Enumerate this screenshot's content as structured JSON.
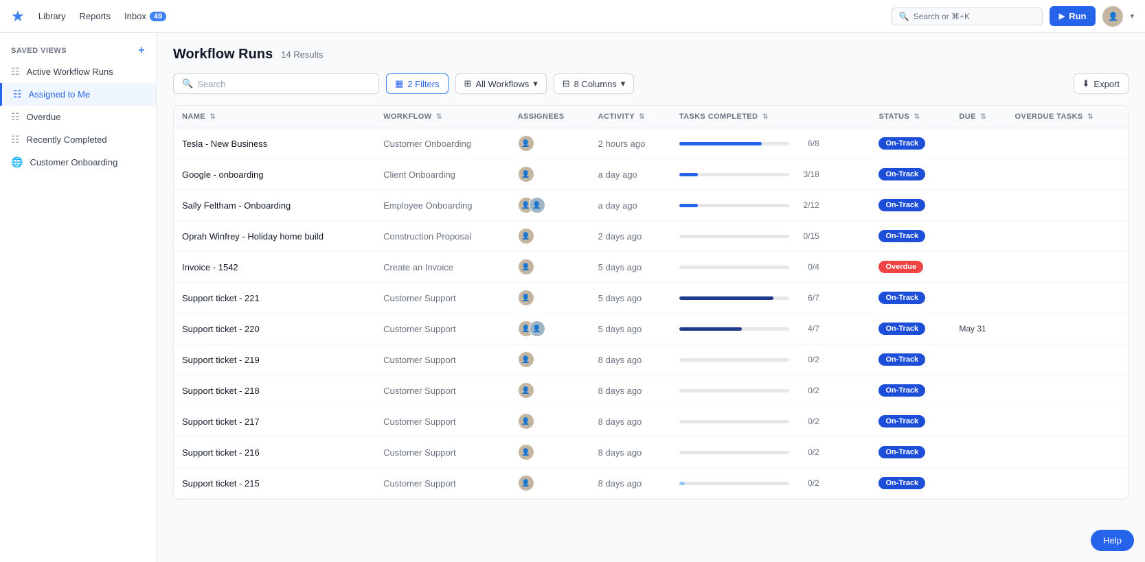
{
  "topnav": {
    "logo_symbol": "★",
    "library_label": "Library",
    "reports_label": "Reports",
    "inbox_label": "Inbox",
    "inbox_count": "49",
    "search_placeholder": "Search or ⌘+K",
    "run_label": "Run",
    "run_icon": "▶"
  },
  "sidebar": {
    "section_label": "SAVED VIEWS",
    "add_icon": "+",
    "items": [
      {
        "id": "active-workflow-runs",
        "label": "Active Workflow Runs",
        "icon": "☷"
      },
      {
        "id": "assigned-to-me",
        "label": "Assigned to Me",
        "icon": "☷",
        "active": true
      },
      {
        "id": "overdue",
        "label": "Overdue",
        "icon": "☷"
      },
      {
        "id": "recently-completed",
        "label": "Recently Completed",
        "icon": "☷"
      },
      {
        "id": "customer-onboarding",
        "label": "Customer Onboarding",
        "icon": "🌐"
      }
    ]
  },
  "main": {
    "title": "Workflow Runs",
    "results": "14 Results",
    "search_placeholder": "Search",
    "filters_label": "2 Filters",
    "workflows_label": "All Workflows",
    "columns_label": "8 Columns",
    "export_label": "Export"
  },
  "table": {
    "columns": [
      {
        "id": "name",
        "label": "NAME"
      },
      {
        "id": "workflow",
        "label": "WORKFLOW"
      },
      {
        "id": "assignees",
        "label": "ASSIGNEES"
      },
      {
        "id": "activity",
        "label": "ACTIVITY"
      },
      {
        "id": "tasks_completed",
        "label": "TASKS COMPLETED"
      },
      {
        "id": "status",
        "label": "STATUS"
      },
      {
        "id": "due",
        "label": "DUE"
      },
      {
        "id": "overdue_tasks",
        "label": "OVERDUE TASKS"
      }
    ],
    "rows": [
      {
        "name": "Tesla - New Business",
        "workflow": "Customer Onboarding",
        "assignees": 1,
        "activity": "2 hours ago",
        "progress": 75,
        "progress_color": "#2563eb",
        "tasks_completed": "6/8",
        "status": "On-Track",
        "status_type": "on-track",
        "due": "",
        "overdue_tasks": ""
      },
      {
        "name": "Google - onboarding",
        "workflow": "Client Onboarding",
        "assignees": 1,
        "activity": "a day ago",
        "progress": 17,
        "progress_color": "#2563eb",
        "tasks_completed": "3/18",
        "status": "On-Track",
        "status_type": "on-track",
        "due": "",
        "overdue_tasks": ""
      },
      {
        "name": "Sally Feltham - Onboarding",
        "workflow": "Employee Onboarding",
        "assignees": 2,
        "activity": "a day ago",
        "progress": 17,
        "progress_color": "#2563eb",
        "tasks_completed": "2/12",
        "status": "On-Track",
        "status_type": "on-track",
        "due": "",
        "overdue_tasks": ""
      },
      {
        "name": "Oprah Winfrey - Holiday home build",
        "workflow": "Construction Proposal",
        "assignees": 1,
        "activity": "2 days ago",
        "progress": 0,
        "progress_color": "#d1d5db",
        "tasks_completed": "0/15",
        "status": "On-Track",
        "status_type": "on-track",
        "due": "",
        "overdue_tasks": ""
      },
      {
        "name": "Invoice - 1542",
        "workflow": "Create an Invoice",
        "assignees": 1,
        "activity": "5 days ago",
        "progress": 0,
        "progress_color": "#fca5a5",
        "tasks_completed": "0/4",
        "status": "Overdue",
        "status_type": "overdue",
        "due": "",
        "overdue_tasks": ""
      },
      {
        "name": "Support ticket - 221",
        "workflow": "Customer Support",
        "assignees": 1,
        "activity": "5 days ago",
        "progress": 86,
        "progress_color": "#1e3a8a",
        "tasks_completed": "6/7",
        "status": "On-Track",
        "status_type": "on-track",
        "due": "",
        "overdue_tasks": ""
      },
      {
        "name": "Support ticket - 220",
        "workflow": "Customer Support",
        "assignees": 2,
        "activity": "5 days ago",
        "progress": 57,
        "progress_color": "#1e3a8a",
        "tasks_completed": "4/7",
        "status": "On-Track",
        "status_type": "on-track",
        "due": "May 31",
        "overdue_tasks": ""
      },
      {
        "name": "Support ticket - 219",
        "workflow": "Customer Support",
        "assignees": 1,
        "activity": "8 days ago",
        "progress": 0,
        "progress_color": "#d1d5db",
        "tasks_completed": "0/2",
        "status": "On-Track",
        "status_type": "on-track",
        "due": "",
        "overdue_tasks": ""
      },
      {
        "name": "Support ticket - 218",
        "workflow": "Customer Support",
        "assignees": 1,
        "activity": "8 days ago",
        "progress": 0,
        "progress_color": "#d1d5db",
        "tasks_completed": "0/2",
        "status": "On-Track",
        "status_type": "on-track",
        "due": "",
        "overdue_tasks": ""
      },
      {
        "name": "Support ticket - 217",
        "workflow": "Customer Support",
        "assignees": 1,
        "activity": "8 days ago",
        "progress": 0,
        "progress_color": "#d1d5db",
        "tasks_completed": "0/2",
        "status": "On-Track",
        "status_type": "on-track",
        "due": "",
        "overdue_tasks": ""
      },
      {
        "name": "Support ticket - 216",
        "workflow": "Customer Support",
        "assignees": 1,
        "activity": "8 days ago",
        "progress": 0,
        "progress_color": "#d1d5db",
        "tasks_completed": "0/2",
        "status": "On-Track",
        "status_type": "on-track",
        "due": "",
        "overdue_tasks": ""
      },
      {
        "name": "Support ticket - 215",
        "workflow": "Customer Support",
        "assignees": 1,
        "activity": "8 days ago",
        "progress": 5,
        "progress_color": "#93c5fd",
        "tasks_completed": "0/2",
        "status": "On-Track",
        "status_type": "on-track",
        "due": "",
        "overdue_tasks": ""
      }
    ]
  },
  "help_label": "Help"
}
